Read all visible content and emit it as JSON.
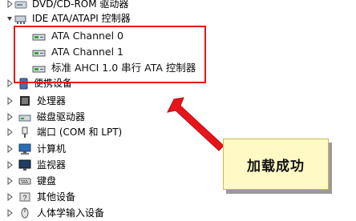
{
  "tree": {
    "items": [
      {
        "label": "DVD/CD-ROM 驱动器",
        "icon": "dvd-drive-icon",
        "expander": "collapsed"
      },
      {
        "label": "IDE ATA/ATAPI 控制器",
        "icon": "ide-controller-icon",
        "expander": "expanded"
      },
      {
        "label": "ATA Channel 0",
        "icon": "ata-channel-icon",
        "expander": "none"
      },
      {
        "label": "ATA Channel 1",
        "icon": "ata-channel-icon",
        "expander": "none"
      },
      {
        "label": "标准 AHCI 1.0 串行 ATA 控制器",
        "icon": "ahci-controller-icon",
        "expander": "none"
      },
      {
        "label": "便携设备",
        "icon": "portable-device-icon",
        "expander": "collapsed"
      },
      {
        "label": "处理器",
        "icon": "processor-icon",
        "expander": "collapsed"
      },
      {
        "label": "磁盘驱动器",
        "icon": "disk-drive-icon",
        "expander": "collapsed"
      },
      {
        "label": "端口 (COM 和 LPT)",
        "icon": "port-icon",
        "expander": "collapsed"
      },
      {
        "label": "计算机",
        "icon": "computer-icon",
        "expander": "collapsed"
      },
      {
        "label": "监视器",
        "icon": "monitor-icon",
        "expander": "collapsed"
      },
      {
        "label": "键盘",
        "icon": "keyboard-icon",
        "expander": "collapsed"
      },
      {
        "label": "其他设备",
        "icon": "other-devices-icon",
        "expander": "collapsed"
      },
      {
        "label": "人体学输入设备",
        "icon": "hid-icon",
        "expander": "collapsed"
      }
    ]
  },
  "annotation": {
    "callout_text": "加载成功",
    "highlight_color": "#e8141c",
    "arrow_color": "#e8141c",
    "callout_bg": "#fff9c6"
  }
}
